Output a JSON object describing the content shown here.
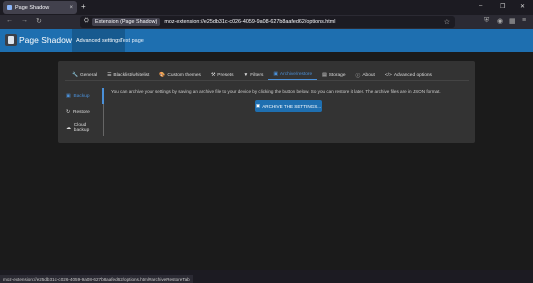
{
  "browser": {
    "tab_title": "Page Shadow",
    "tab_close": "×",
    "new_tab": "+",
    "window_minimize": "–",
    "window_restore": "❐",
    "window_close": "✕",
    "nav_back": "←",
    "nav_forward": "→",
    "nav_reload": "↻",
    "url_badge": "Extension (Page Shadow)",
    "url": "moz-extension://e25db31c-c026-4059-9a08-627b8aafed62/options.html",
    "bookmark_star": "☆"
  },
  "header": {
    "app_title": "Page Shadow",
    "nav": [
      {
        "label": "Advanced settings"
      },
      {
        "label": "Test page"
      }
    ]
  },
  "tabs": [
    {
      "icon": "wrench-icon",
      "glyph": "🔧",
      "label": "General"
    },
    {
      "icon": "list-icon",
      "glyph": "☰",
      "label": "Blacklist/whitelist"
    },
    {
      "icon": "palette-icon",
      "glyph": "🎨",
      "label": "Custom themes"
    },
    {
      "icon": "tools-icon",
      "glyph": "⚒",
      "label": "Presets"
    },
    {
      "icon": "filter-icon",
      "glyph": "▼",
      "label": "Filters"
    },
    {
      "icon": "archive-icon",
      "glyph": "▣",
      "label": "Archive/restore"
    },
    {
      "icon": "database-icon",
      "glyph": "▤",
      "label": "Storage"
    },
    {
      "icon": "info-icon",
      "glyph": "ⓘ",
      "label": "About"
    },
    {
      "icon": "code-icon",
      "glyph": "</>",
      "label": "Advanced options"
    }
  ],
  "sidebar": [
    {
      "glyph": "▣",
      "label": "Backup"
    },
    {
      "glyph": "↻",
      "label": "Restore"
    },
    {
      "glyph": "☁",
      "label": "Cloud backup"
    }
  ],
  "content": {
    "description": "You can archive your settings by saving an archive file to your device by clicking the button below. So you can restore it later. The archive files are in JSON format.",
    "archive_button": "ARCHIVE THE SETTINGS...",
    "archive_glyph": "▣"
  },
  "status": "moz-extension://e25db31c-c026-4059-9a08-627b8aafed62/options.html#archiveRestoreTab",
  "colors": {
    "accent": "#1e6fb0",
    "active_link": "#4a90d9"
  }
}
